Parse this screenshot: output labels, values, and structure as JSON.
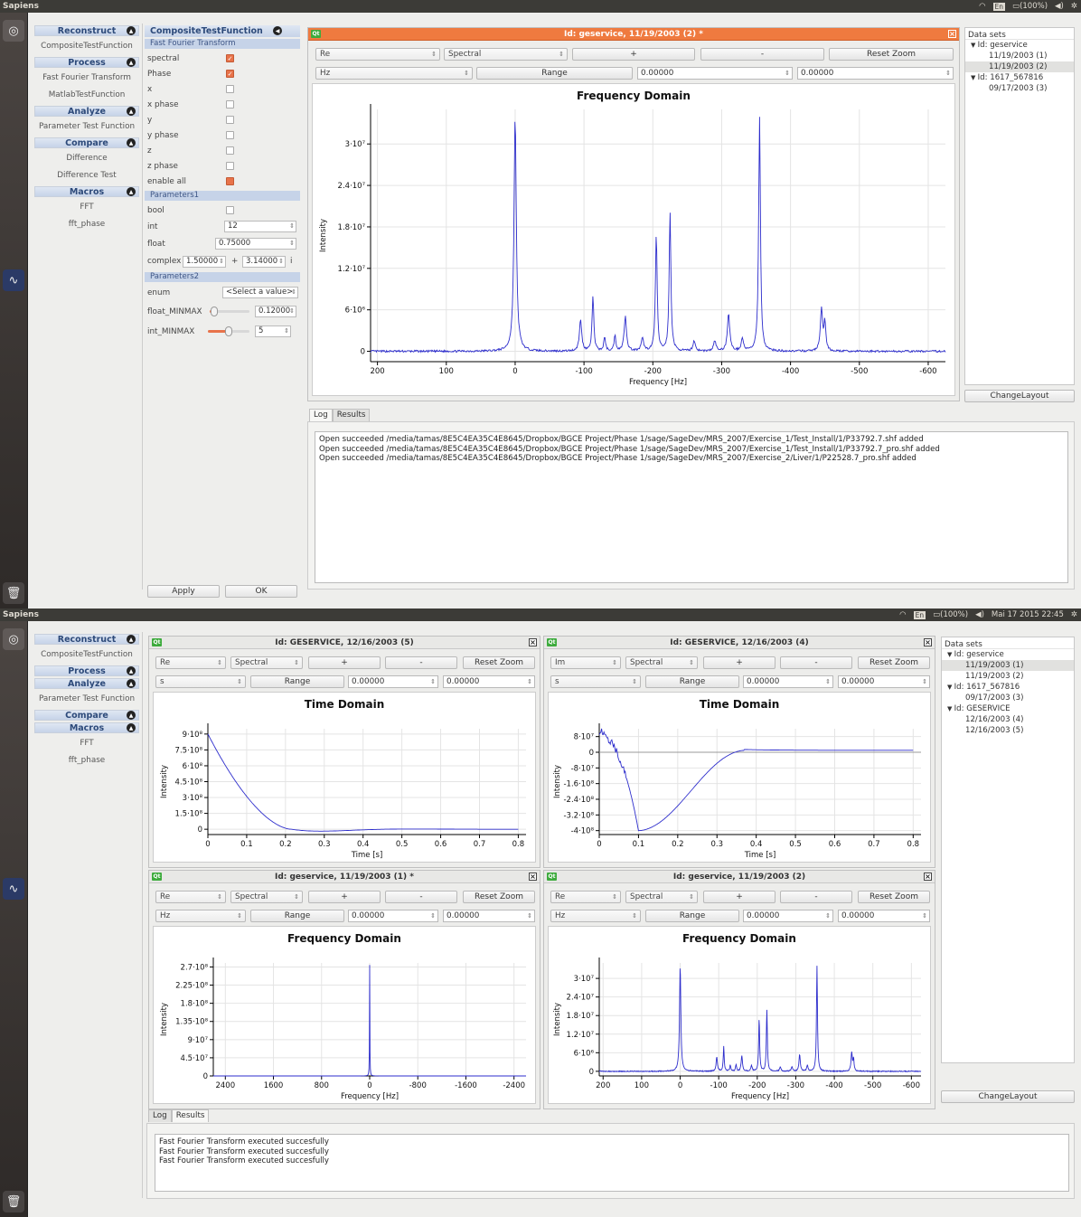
{
  "app": {
    "title": "Sapiens"
  },
  "tray": {
    "lang": "En",
    "battery": "(100%)",
    "clock_s1": "",
    "clock_s2": "Mai 17 2015 22:45"
  },
  "sidebar": {
    "s1": [
      {
        "t": "h",
        "label": "Reconstruct"
      },
      {
        "t": "i",
        "label": "CompositeTestFunction"
      },
      {
        "t": "h",
        "label": "Process"
      },
      {
        "t": "i",
        "label": "Fast Fourier Transform"
      },
      {
        "t": "i",
        "label": "MatlabTestFunction"
      },
      {
        "t": "h",
        "label": "Analyze"
      },
      {
        "t": "i",
        "label": "Parameter Test Function"
      },
      {
        "t": "h",
        "label": "Compare"
      },
      {
        "t": "i",
        "label": "Difference"
      },
      {
        "t": "i",
        "label": "Difference Test"
      },
      {
        "t": "h",
        "label": "Macros"
      },
      {
        "t": "i",
        "label": "FFT"
      },
      {
        "t": "i",
        "label": "fft_phase"
      }
    ],
    "s2": [
      {
        "t": "h",
        "label": "Reconstruct"
      },
      {
        "t": "i",
        "label": "CompositeTestFunction"
      },
      {
        "t": "h",
        "label": "Process"
      },
      {
        "t": "h",
        "label": "Analyze"
      },
      {
        "t": "i",
        "label": "Parameter Test Function"
      },
      {
        "t": "h",
        "label": "Compare"
      },
      {
        "t": "h",
        "label": "Macros"
      },
      {
        "t": "i",
        "label": "FFT"
      },
      {
        "t": "i",
        "label": "fft_phase"
      }
    ]
  },
  "params": {
    "header": "CompositeTestFunction",
    "section1": "Fast Fourier Transform",
    "checks": [
      {
        "label": "spectral",
        "on": true
      },
      {
        "label": "Phase",
        "on": true
      },
      {
        "label": "x",
        "on": false
      },
      {
        "label": "x phase",
        "on": false
      },
      {
        "label": "y",
        "on": false
      },
      {
        "label": "y phase",
        "on": false
      },
      {
        "label": "z",
        "on": false
      },
      {
        "label": "z phase",
        "on": false
      },
      {
        "label": "enable all",
        "on": "partial"
      }
    ],
    "section2": "Parameters1",
    "bool_label": "bool",
    "int_label": "int",
    "int_value": "12",
    "float_label": "float",
    "float_value": "0.75000",
    "complex_label": "complex",
    "complex_re": "1.50000",
    "complex_plus": "+",
    "complex_im": "3.14000",
    "complex_i": "i",
    "section3": "Parameters2",
    "enum_label": "enum",
    "enum_value": "<Select a value>",
    "fmm_label": "float_MINMAX",
    "fmm_value": "0.12000",
    "fmm_level": 0.12,
    "imm_label": "int_MINMAX",
    "imm_value": "5",
    "imm_level": 0.5,
    "apply": "Apply",
    "ok": "OK"
  },
  "win1": {
    "title": "Id: geservice, 11/19/2003 (2) *",
    "sel1": "Re",
    "sel2": "Spectral",
    "plus": "+",
    "minus": "-",
    "reset": "Reset Zoom",
    "unit": "Hz",
    "range": "Range",
    "from": "0.00000",
    "to": "0.00000"
  },
  "datasets1": {
    "header": "Data sets",
    "rows": [
      {
        "indent": 0,
        "label": "Id: geservice",
        "arrow": "▼"
      },
      {
        "indent": 1,
        "label": "11/19/2003 (1)"
      },
      {
        "indent": 1,
        "label": "11/19/2003 (2)",
        "sel": true
      },
      {
        "indent": 0,
        "label": "Id: 1617_567816",
        "arrow": "▼"
      },
      {
        "indent": 1,
        "label": "09/17/2003 (3)"
      }
    ],
    "change": "ChangeLayout"
  },
  "log1": {
    "tabs": [
      "Log",
      "Results"
    ],
    "lines": [
      "Open succeeded /media/tamas/8E5C4EA35C4E8645/Dropbox/BGCE Project/Phase 1/sage/SageDev/MRS_2007/Exercise_1/Test_Install/1/P33792.7.shf added",
      "Open succeeded /media/tamas/8E5C4EA35C4E8645/Dropbox/BGCE Project/Phase 1/sage/SageDev/MRS_2007/Exercise_1/Test_Install/1/P33792.7_pro.shf added",
      "Open succeeded /media/tamas/8E5C4EA35C4E8645/Dropbox/BGCE Project/Phase 1/sage/SageDev/MRS_2007/Exercise_2/Liver/1/P22528.7_pro.shf added"
    ]
  },
  "wins2": [
    {
      "title": "Id: GESERVICE, 12/16/2003 (5)",
      "sel1": "Re",
      "sel2": "Spectral",
      "plus": "+",
      "minus": "-",
      "reset": "Reset Zoom",
      "unit": "s",
      "range": "Range",
      "from": "0.00000",
      "to": "0.00000"
    },
    {
      "title": "Id: GESERVICE, 12/16/2003 (4)",
      "sel1": "Im",
      "sel2": "Spectral",
      "plus": "+",
      "minus": "-",
      "reset": "Reset Zoom",
      "unit": "s",
      "range": "Range",
      "from": "0.00000",
      "to": "0.00000"
    },
    {
      "title": "Id: geservice, 11/19/2003 (1) *",
      "sel1": "Re",
      "sel2": "Spectral",
      "plus": "+",
      "minus": "-",
      "reset": "Reset Zoom",
      "unit": "Hz",
      "range": "Range",
      "from": "0.00000",
      "to": "0.00000"
    },
    {
      "title": "Id: geservice, 11/19/2003 (2)",
      "sel1": "Re",
      "sel2": "Spectral",
      "plus": "+",
      "minus": "-",
      "reset": "Reset Zoom",
      "unit": "Hz",
      "range": "Range",
      "from": "0.00000",
      "to": "0.00000"
    }
  ],
  "datasets2": {
    "header": "Data sets",
    "rows": [
      {
        "indent": 0,
        "label": "Id: geservice",
        "arrow": "▼"
      },
      {
        "indent": 1,
        "label": "11/19/2003 (1)",
        "sel": true
      },
      {
        "indent": 1,
        "label": "11/19/2003 (2)"
      },
      {
        "indent": 0,
        "label": "Id: 1617_567816",
        "arrow": "▼"
      },
      {
        "indent": 1,
        "label": "09/17/2003 (3)"
      },
      {
        "indent": 0,
        "label": "Id: GESERVICE",
        "arrow": "▼"
      },
      {
        "indent": 1,
        "label": "12/16/2003 (4)"
      },
      {
        "indent": 1,
        "label": "12/16/2003 (5)"
      }
    ],
    "change": "ChangeLayout"
  },
  "log2": {
    "tabs": [
      "Log",
      "Results"
    ],
    "lines": [
      "Fast Fourier Transform executed succesfully",
      "Fast Fourier Transform executed succesfully",
      "Fast Fourier Transform executed succesfully"
    ]
  },
  "chart_data": [
    {
      "type": "line",
      "title": "Frequency Domain",
      "xlabel": "Frequency [Hz]",
      "ylabel": "Intensity",
      "xlim": [
        210,
        -625
      ],
      "ylim": [
        -1500000,
        35000000
      ],
      "xticks": [
        200,
        100,
        0,
        -100,
        -200,
        -300,
        -400,
        -500,
        -600
      ],
      "yticks": [
        0,
        6000000,
        12000000,
        18000000,
        24000000,
        30000000
      ],
      "ytick_labels": [
        "0",
        "6·10⁶",
        "1.2·10⁷",
        "1.8·10⁷",
        "2.4·10⁷",
        "3·10⁷"
      ],
      "peaks": [
        {
          "x": 0,
          "y": 34000000,
          "w": 2
        },
        {
          "x": -95,
          "y": 4500000,
          "w": 2
        },
        {
          "x": -113,
          "y": 8000000,
          "w": 1.5
        },
        {
          "x": -160,
          "y": 5000000,
          "w": 2
        },
        {
          "x": -205,
          "y": 17000000,
          "w": 1.5
        },
        {
          "x": -225,
          "y": 20000000,
          "w": 1.5
        },
        {
          "x": -310,
          "y": 5500000,
          "w": 2
        },
        {
          "x": -355,
          "y": 34000000,
          "w": 1.5
        },
        {
          "x": -445,
          "y": 6000000,
          "w": 2
        },
        {
          "x": -450,
          "y": 4000000,
          "w": 1.5
        },
        {
          "x": -130,
          "y": 2000000,
          "w": 1.5
        },
        {
          "x": -145,
          "y": 2200000,
          "w": 1.5
        },
        {
          "x": -185,
          "y": 1800000,
          "w": 2
        },
        {
          "x": -260,
          "y": 1500000,
          "w": 2
        },
        {
          "x": -290,
          "y": 1500000,
          "w": 2
        },
        {
          "x": -330,
          "y": 1800000,
          "w": 2
        }
      ]
    },
    {
      "type": "line",
      "title": "Time Domain",
      "xlabel": "Time [s]",
      "ylabel": "Intensity",
      "xlim": [
        0,
        0.82
      ],
      "ylim": [
        -50000000,
        950000000
      ],
      "xticks": [
        0,
        0.1,
        0.2,
        0.3,
        0.4,
        0.5,
        0.6,
        0.7,
        0.8
      ],
      "yticks": [
        0,
        150000000,
        300000000,
        450000000,
        600000000,
        750000000,
        900000000
      ],
      "ytick_labels": [
        "0",
        "1.5·10⁸",
        "3·10⁸",
        "4.5·10⁸",
        "6·10⁸",
        "7.5·10⁸",
        "9·10⁸"
      ],
      "amp": 900000000,
      "t0": 0.215,
      "period": 0.5,
      "tau": 0.15
    },
    {
      "type": "line",
      "title": "Time Domain",
      "xlabel": "Time [s]",
      "ylabel": "Intensity",
      "xlim": [
        0,
        0.82
      ],
      "ylim": [
        -420000000,
        120000000
      ],
      "xticks": [
        0,
        0.1,
        0.2,
        0.3,
        0.4,
        0.5,
        0.6,
        0.7,
        0.8
      ],
      "yticks": [
        -400000000,
        -320000000,
        -240000000,
        -160000000,
        -80000000,
        0,
        80000000
      ],
      "ytick_labels": [
        "-4·10⁸",
        "-3.2·10⁸",
        "-2.4·10⁸",
        "-1.6·10⁸",
        "-8·10⁷",
        "0",
        "8·10⁷"
      ],
      "min": -400000000,
      "tmin": 0.1,
      "rise": 0.37,
      "plateau": 10000000
    },
    {
      "type": "line",
      "title": "Frequency Domain",
      "xlabel": "Frequency [Hz]",
      "ylabel": "Intensity",
      "xlim": [
        2600,
        -2600
      ],
      "ylim": [
        0,
        280000000
      ],
      "xticks": [
        2400,
        1600,
        800,
        0,
        -800,
        -1600,
        -2400
      ],
      "yticks": [
        0,
        45000000,
        90000000,
        135000000,
        180000000,
        225000000,
        270000000
      ],
      "ytick_labels": [
        "0",
        "4.5·10⁷",
        "9·10⁷",
        "1.35·10⁸",
        "1.8·10⁸",
        "2.25·10⁸",
        "2.7·10⁸"
      ],
      "peaks": [
        {
          "x": 0,
          "y": 275000000,
          "w": 3
        }
      ]
    },
    {
      "type": "line",
      "title": "Frequency Domain",
      "xlabel": "Frequency [Hz]",
      "ylabel": "Intensity",
      "xlim": [
        210,
        -625
      ],
      "ylim": [
        -1500000,
        35000000
      ],
      "xticks": [
        200,
        100,
        0,
        -100,
        -200,
        -300,
        -400,
        -500,
        -600
      ],
      "yticks": [
        0,
        6000000,
        12000000,
        18000000,
        24000000,
        30000000
      ],
      "ytick_labels": [
        "0",
        "6·10⁶",
        "1.2·10⁷",
        "1.8·10⁷",
        "2.4·10⁷",
        "3·10⁷"
      ],
      "peaks": [
        {
          "x": 0,
          "y": 34000000,
          "w": 2
        },
        {
          "x": -95,
          "y": 4500000,
          "w": 2
        },
        {
          "x": -113,
          "y": 8000000,
          "w": 1.5
        },
        {
          "x": -160,
          "y": 5000000,
          "w": 2
        },
        {
          "x": -205,
          "y": 17000000,
          "w": 1.5
        },
        {
          "x": -225,
          "y": 20000000,
          "w": 1.5
        },
        {
          "x": -310,
          "y": 5500000,
          "w": 2
        },
        {
          "x": -355,
          "y": 34000000,
          "w": 1.5
        },
        {
          "x": -445,
          "y": 6000000,
          "w": 2
        },
        {
          "x": -450,
          "y": 4000000,
          "w": 1.5
        },
        {
          "x": -130,
          "y": 2000000,
          "w": 1.5
        },
        {
          "x": -145,
          "y": 2200000,
          "w": 1.5
        },
        {
          "x": -185,
          "y": 1800000,
          "w": 2
        },
        {
          "x": -260,
          "y": 1500000,
          "w": 2
        },
        {
          "x": -290,
          "y": 1500000,
          "w": 2
        },
        {
          "x": -330,
          "y": 1800000,
          "w": 2
        }
      ]
    }
  ]
}
